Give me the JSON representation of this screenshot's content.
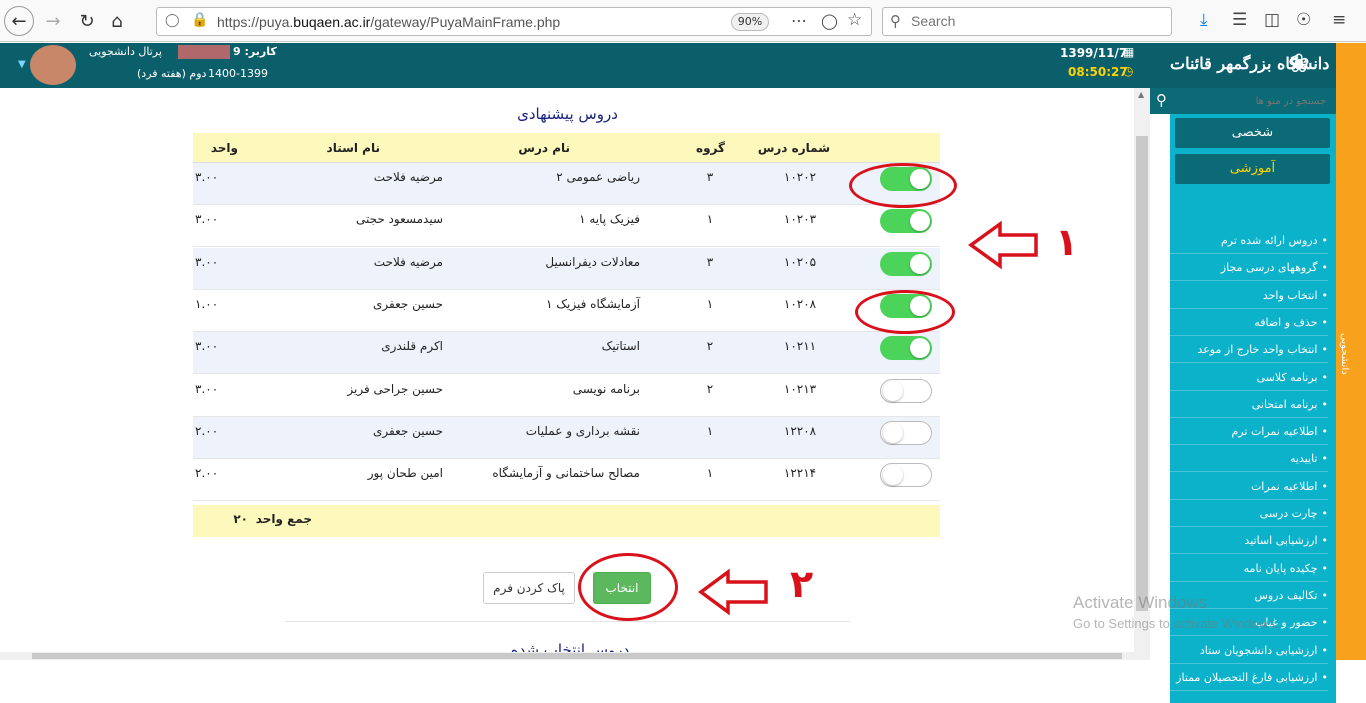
{
  "browser": {
    "url_prefix": "https://puya.",
    "url_domain": "buqaen.ac.ir",
    "url_path": "/gateway/PuyaMainFrame.php",
    "zoom": "90%",
    "search_placeholder": "Search"
  },
  "header": {
    "user_label": "کاربر: 9",
    "portal_label": "پرتال دانشجویی",
    "term_text": "دوم (هفته فرد)",
    "year_text": "1400-1399",
    "date": "1399/11/7",
    "time": "08:50:27"
  },
  "sidebar": {
    "logo_text": "دانشگاه بزرگمهر قائنات",
    "search_placeholder": "جستجو در منو ها",
    "tab_personal": "شخصی",
    "tab_education": "آموزشی",
    "items": [
      "دروس ارائه شده ترم",
      "گروههای درسی مجاز",
      "انتخاب واحد",
      "حذف و اضافه",
      "انتخاب واحد خارج از موعد",
      "برنامه کلاسی",
      "برنامه امتحانی",
      "اطلاعیه نمرات ترم",
      "تاییدیه",
      "اطلاعیه نمرات",
      "چارت درسی",
      "ارزشیابی اساتید",
      "چکیده پایان نامه",
      "تکالیف دروس",
      "حضور و غیاب",
      "ارزشیابی دانشجویان ستاد",
      "ارزشیابی فارغ التحصیلان ممتاز"
    ],
    "side_tab_vertical": "دانشجویی"
  },
  "main": {
    "title": "دروس پیشنهادی",
    "columns": {
      "code": "شماره درس",
      "group": "گروه",
      "name": "نام درس",
      "teacher": "نام استاد",
      "units": "واحد"
    },
    "rows": [
      {
        "code": "۱۰۲۰۲",
        "group": "۳",
        "name": "ریاضی عمومی ۲",
        "teacher": "مرضیه فلاحت",
        "units": "۳.۰۰",
        "selected": true
      },
      {
        "code": "۱۰۲۰۳",
        "group": "۱",
        "name": "فیزیک پایه ۱",
        "teacher": "سیدمسعود حجتی",
        "units": "۳.۰۰",
        "selected": true
      },
      {
        "code": "۱۰۲۰۵",
        "group": "۳",
        "name": "معادلات دیفرانسیل",
        "teacher": "مرضیه فلاحت",
        "units": "۳.۰۰",
        "selected": true
      },
      {
        "code": "۱۰۲۰۸",
        "group": "۱",
        "name": "آزمایشگاه فیزیک ۱",
        "teacher": "حسین جعفری",
        "units": "۱.۰۰",
        "selected": true
      },
      {
        "code": "۱۰۲۱۱",
        "group": "۲",
        "name": "استاتیک",
        "teacher": "اکرم قلندری",
        "units": "۳.۰۰",
        "selected": true
      },
      {
        "code": "۱۰۲۱۳",
        "group": "۲",
        "name": "برنامه نویسی",
        "teacher": "حسین جراحی فریز",
        "units": "۳.۰۰",
        "selected": false
      },
      {
        "code": "۱۲۲۰۸",
        "group": "۱",
        "name": "نقشه برداری و عملیات",
        "teacher": "حسین جعفری",
        "units": "۲.۰۰",
        "selected": false
      },
      {
        "code": "۱۲۲۱۴",
        "group": "۱",
        "name": "مصالح ساختمانی و آزمایشگاه",
        "teacher": "امین طحان پور",
        "units": "۲.۰۰",
        "selected": false
      }
    ],
    "total_label": "جمع واحد",
    "total_value": "۲۰",
    "select_button": "انتخاب",
    "clear_button": "پاک کردن فرم",
    "next_section_title": "دروس انتخاب شده"
  },
  "annotations": {
    "label_1": "۱",
    "label_2": "۲"
  },
  "watermark": {
    "line1": "Activate Windows",
    "line2": "Go to Settings to activate Windows."
  },
  "colors": {
    "header_teal": "#0b5f6a",
    "menu_cyan": "#0cb2ca",
    "toggle_on": "#4cd35a",
    "table_header": "#fdf8bc",
    "annotation_red": "#d8111a",
    "select_green": "#5cb85c"
  }
}
